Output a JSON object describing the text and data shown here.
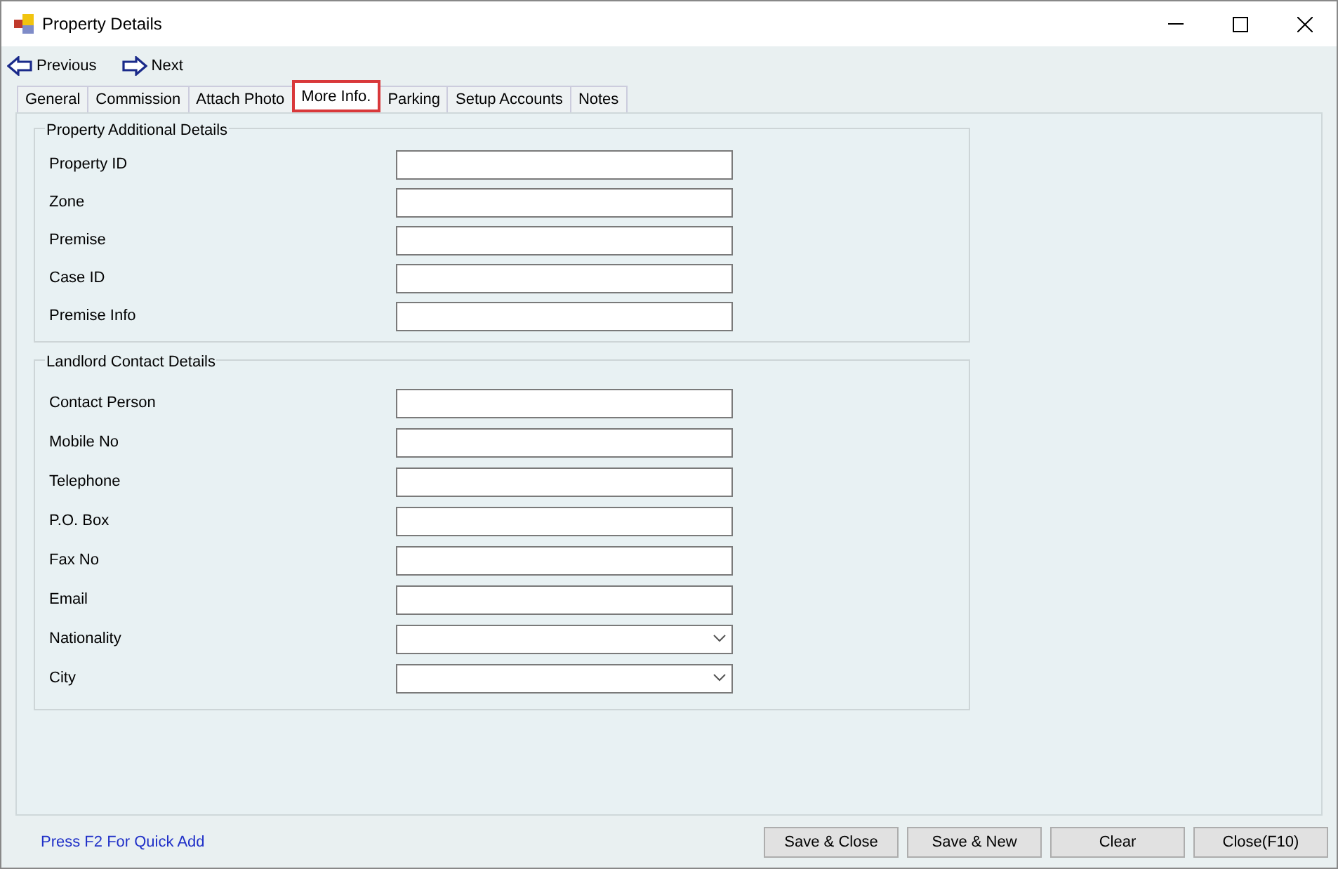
{
  "window": {
    "title": "Property Details"
  },
  "toolbar": [
    {
      "label": "Previous",
      "kind": "previous"
    },
    {
      "label": "Next",
      "kind": "next"
    }
  ],
  "tabs": [
    {
      "label": "General",
      "selected": false
    },
    {
      "label": "Commission",
      "selected": false
    },
    {
      "label": "Attach Photo",
      "selected": false
    },
    {
      "label": "More Info.",
      "selected": true
    },
    {
      "label": "Parking",
      "selected": false
    },
    {
      "label": "Setup Accounts",
      "selected": false
    },
    {
      "label": "Notes",
      "selected": false
    }
  ],
  "groups": [
    {
      "title": "Property Additional Details",
      "fields": [
        {
          "label": "Property ID",
          "kind": "text"
        },
        {
          "label": "Zone",
          "kind": "text"
        },
        {
          "label": "Premise",
          "kind": "text"
        },
        {
          "label": "Case ID",
          "kind": "text"
        },
        {
          "label": "Premise Info",
          "kind": "text"
        }
      ]
    },
    {
      "title": "Landlord Contact Details",
      "fields": [
        {
          "label": "Contact Person",
          "kind": "text"
        },
        {
          "label": "Mobile No",
          "kind": "text"
        },
        {
          "label": "Telephone",
          "kind": "text"
        },
        {
          "label": "P.O. Box",
          "kind": "text"
        },
        {
          "label": "Fax No",
          "kind": "text"
        },
        {
          "label": "Email",
          "kind": "text"
        },
        {
          "label": "Nationality",
          "kind": "select"
        },
        {
          "label": "City",
          "kind": "select"
        }
      ]
    }
  ],
  "footer": {
    "hint": "Press F2 For Quick Add",
    "buttons": [
      "Save & Close",
      "Save & New",
      "Clear",
      "Close(F10)"
    ]
  }
}
